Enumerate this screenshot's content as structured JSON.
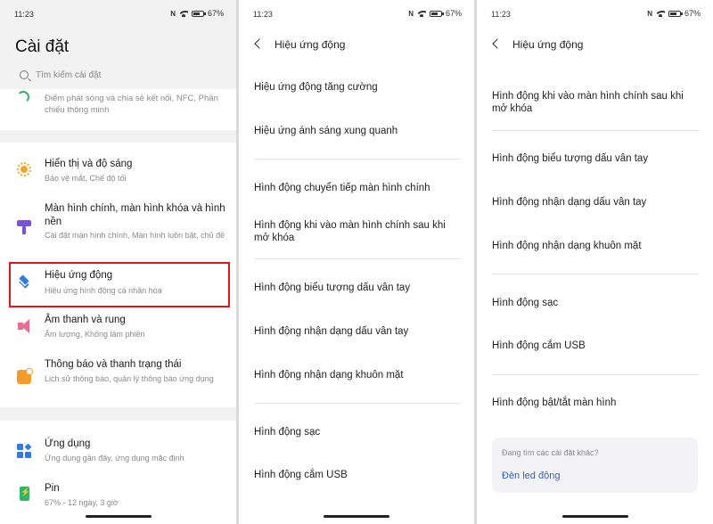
{
  "status": {
    "time": "11:23",
    "nfc": "N",
    "battery": "67%"
  },
  "battery_level": 0.67,
  "panel1": {
    "title": "Cài đặt",
    "search_placeholder": "Tìm kiếm cài đặt",
    "partial_item": {
      "subtitle": "Điểm phát sóng và chia sẻ kết nối, NFC, Phản chiếu thông minh",
      "icon": "hotspot-icon"
    },
    "items": [
      {
        "title": "Hiển thị và độ sáng",
        "subtitle": "Bảo vệ mắt, Chế độ tối",
        "icon": "sun-icon",
        "color": "#f5a623"
      },
      {
        "title": "Màn hình chính, màn hình khóa và hình nền",
        "subtitle": "Cài đặt màn hình chính, Màn hình luôn bật, chủ đề",
        "icon": "brush-icon",
        "color": "#7b4fe0"
      },
      {
        "title": "Hiệu ứng động",
        "subtitle": "Hiệu ứng hình động cá nhân hóa",
        "icon": "layers-icon",
        "color": "#2f7be5"
      },
      {
        "title": "Âm thanh và rung",
        "subtitle": "Âm lượng, Không làm phiền",
        "icon": "sound-icon",
        "color": "#f06a8f"
      },
      {
        "title": "Thông báo và thanh trạng thái",
        "subtitle": "Lịch sử thông báo, quản lý thông báo ứng dụng",
        "icon": "notification-icon",
        "color": "#f39c2c"
      },
      {
        "title": "Ứng dụng",
        "subtitle": "Ứng dụng gần đây, ứng dụng mặc định",
        "icon": "apps-icon",
        "color": "#2f7be5"
      },
      {
        "title": "Pin",
        "subtitle": "67% - 12 ngày, 3 giờ",
        "icon": "battery-icon",
        "color": "#2fb36b"
      }
    ],
    "highlight_color": "#e0141b"
  },
  "panel2": {
    "title": "Hiệu ứng động",
    "rows": [
      "Hiệu ứng động tăng cường",
      "Hiệu ứng ánh sáng xung quanh",
      "Hình động chuyển tiếp màn hình chính",
      "Hình động khi vào màn hình chính sau khi mở khóa",
      "Hình động biểu tượng dấu vân tay",
      "Hình động nhận dạng dấu vân tay",
      "Hình động nhận dạng khuôn mặt",
      "Hình động sạc",
      "Hình động cắm USB"
    ]
  },
  "panel3": {
    "title": "Hiệu ứng động",
    "rows": [
      "Hình động khi vào màn hình chính sau khi mở khóa",
      "Hình động biểu tượng dấu vân tay",
      "Hình động nhận dạng dấu vân tay",
      "Hình động nhận dạng khuôn mặt",
      "Hình động sạc",
      "Hình động cắm USB",
      "Hình động bật/tắt màn hình"
    ],
    "more_question": "Đang tìm các cài đặt khác?",
    "more_link": "Đèn led động",
    "link_color": "#2f62c9"
  }
}
